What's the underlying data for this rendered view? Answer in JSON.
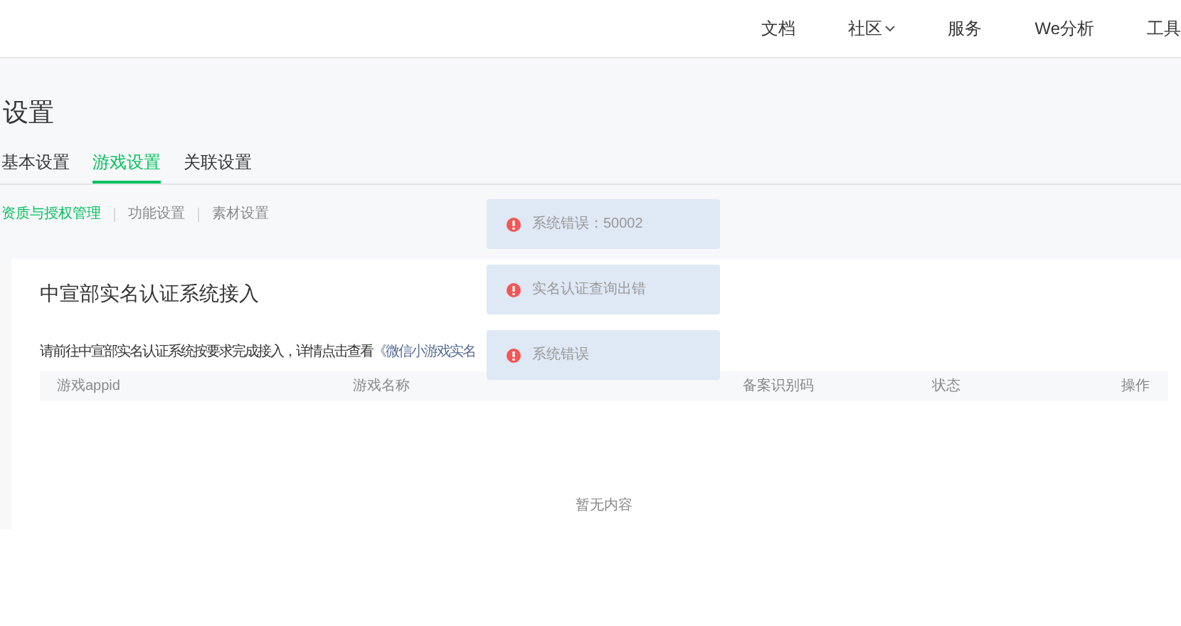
{
  "nav": [
    {
      "label": "文档",
      "caret": false
    },
    {
      "label": "社区",
      "caret": true
    },
    {
      "label": "服务",
      "caret": false
    },
    {
      "label": "We分析",
      "caret": false
    },
    {
      "label": "工具",
      "caret": false
    }
  ],
  "page_title": "设置",
  "tabs": [
    {
      "label": "基本设置",
      "selected": false
    },
    {
      "label": "游戏设置",
      "selected": true
    },
    {
      "label": "关联设置",
      "selected": false
    }
  ],
  "subtabs": [
    {
      "label": "资质与授权管理",
      "selected": true
    },
    {
      "label": "功能设置",
      "selected": false
    },
    {
      "label": "素材设置",
      "selected": false
    }
  ],
  "card": {
    "title": "中宣部实名认证系统接入",
    "notice": "请前往中宣部实名认证系统按要求完成接入，详情点击查看",
    "link": "《微信小游戏实名",
    "table": {
      "columns": [
        "游戏appid",
        "游戏名称",
        "备案识别码",
        "状态",
        "操作"
      ],
      "empty": "暂无内容"
    }
  },
  "toasts": [
    "系统错误：50002",
    "实名认证查询出错",
    "系统错误"
  ]
}
